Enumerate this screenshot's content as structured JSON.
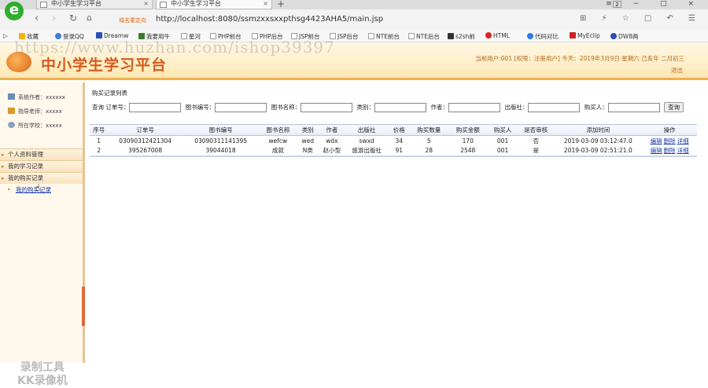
{
  "browser": {
    "tabs": [
      {
        "label": "中小学生学习平台"
      },
      {
        "label": "中小学生学习平台"
      }
    ],
    "new_tab": "+",
    "tab_count": "2",
    "secure_label": "域名重定向",
    "url": "http://localhost:8080/ssmzxxsxxpthsg4423AHA5/main.jsp",
    "bookmarks": [
      "收藏",
      "登录QQ",
      "Dreamw",
      "我要用牛",
      "星河",
      "PHP前台",
      "PHP后台",
      "JSP前台",
      "JSP后台",
      "NTE前台",
      "NTE后台",
      "s2sh前",
      "HTML",
      "代码对比",
      "MyEclip",
      "DW8两"
    ]
  },
  "header": {
    "title": "中小学生学习平台",
    "watermark": "https://www.huzhan.com/ishop39397",
    "user_info": "当前用户:001 [权限：注册用户] 今天：2019年3月9日 星期六 己亥年 二月初三",
    "logout": "退出"
  },
  "sidebar": {
    "profile": [
      {
        "label": "系统作者：xxxxxx"
      },
      {
        "label": "指导老师：xxxxx"
      },
      {
        "label": "所在学校：xxxxx"
      }
    ],
    "menus": [
      "个人资料管理",
      "我的学习记录",
      "我的购买记录"
    ],
    "submenu": "我的购买记录",
    "rec_watermark_1": "录制工具",
    "rec_watermark_2": "KK录像机"
  },
  "main": {
    "page_title": "购买记录列表",
    "search": {
      "query_label": "查询",
      "fields": [
        "订单号：",
        "图书编号：",
        "图书名称：",
        "类别：",
        "作者：",
        "出版社：",
        "购买人："
      ],
      "button": "查询"
    },
    "columns": [
      "序号",
      "订单号",
      "图书编号",
      "图书名称",
      "类别",
      "作者",
      "出版社",
      "价格",
      "购买数量",
      "购买金额",
      "购买人",
      "是否审核",
      "添加时间",
      "操作"
    ],
    "rows": [
      {
        "seq": "1",
        "order": "03090312421304",
        "book_id": "03090311141395",
        "book_name": "wefcw",
        "category": "wed",
        "author": "wdx",
        "publisher": "swxd",
        "price": "34",
        "qty": "5",
        "amount": "170",
        "buyer": "001",
        "audited": "否",
        "time": "2019-03-09 03:12:47.0"
      },
      {
        "seq": "2",
        "order": "395267008",
        "book_id": "39044018",
        "book_name": "成就",
        "category": "N类",
        "author": "赵小型",
        "publisher": "旅游出版社",
        "price": "91",
        "qty": "28",
        "amount": "2548",
        "buyer": "001",
        "audited": "是",
        "time": "2019-03-09 02:51:21.0"
      }
    ],
    "actions": [
      "编辑",
      "删除",
      "详细"
    ]
  },
  "colors": {
    "title_orange": "#d55a1c",
    "link_blue": "#1c3ca8",
    "header_border": "#f0b04a"
  }
}
